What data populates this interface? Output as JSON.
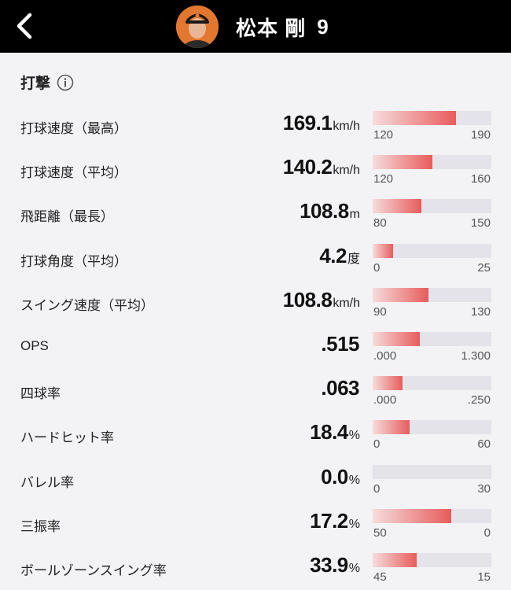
{
  "header": {
    "player_name": "松本 剛",
    "player_number": "9"
  },
  "section": {
    "title": "打撃"
  },
  "colors": {
    "header_bg": "#000000",
    "bar_track": "#e4e3e9",
    "bar_fill_light": "#f6dcdc",
    "bar_fill_dark": "#e85c5c",
    "avatar_bg": "#e3772f"
  },
  "icons": {
    "back": "chevron-left-icon",
    "info": "info-icon"
  },
  "stats": [
    {
      "label": "打球速度（最高）",
      "value": "169.1",
      "unit": "km/h",
      "min": "120",
      "max": "190",
      "fill_fraction": 0.7
    },
    {
      "label": "打球速度（平均）",
      "value": "140.2",
      "unit": "km/h",
      "min": "120",
      "max": "160",
      "fill_fraction": 0.5
    },
    {
      "label": "飛距離（最長）",
      "value": "108.8",
      "unit": "m",
      "min": "80",
      "max": "150",
      "fill_fraction": 0.41
    },
    {
      "label": "打球角度（平均）",
      "value": "4.2",
      "unit": "度",
      "min": "0",
      "max": "25",
      "fill_fraction": 0.17
    },
    {
      "label": "スイング速度（平均）",
      "value": "108.8",
      "unit": "km/h",
      "min": "90",
      "max": "130",
      "fill_fraction": 0.47
    },
    {
      "label": "OPS",
      "value": ".515",
      "unit": "",
      "min": ".000",
      "max": "1.300",
      "fill_fraction": 0.4
    },
    {
      "label": "四球率",
      "value": ".063",
      "unit": "",
      "min": ".000",
      "max": ".250",
      "fill_fraction": 0.25
    },
    {
      "label": "ハードヒット率",
      "value": "18.4",
      "unit": "%",
      "min": "0",
      "max": "60",
      "fill_fraction": 0.31
    },
    {
      "label": "バレル率",
      "value": "0.0",
      "unit": "%",
      "min": "0",
      "max": "30",
      "fill_fraction": 0.0
    },
    {
      "label": "三振率",
      "value": "17.2",
      "unit": "%",
      "min": "50",
      "max": "0",
      "fill_fraction": 0.66
    },
    {
      "label": "ボールゾーンスイング率",
      "value": "33.9",
      "unit": "%",
      "min": "45",
      "max": "15",
      "fill_fraction": 0.37
    }
  ]
}
